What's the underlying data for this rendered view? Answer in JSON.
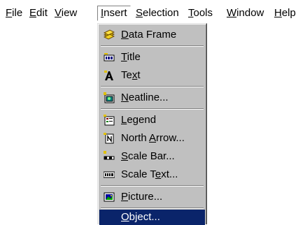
{
  "menubar": {
    "items": [
      {
        "accel": "F",
        "rest": "ile"
      },
      {
        "accel": "E",
        "rest": "dit"
      },
      {
        "accel": "V",
        "rest": "iew"
      },
      {
        "accel": "I",
        "rest": "nsert"
      },
      {
        "accel": "S",
        "rest": "election"
      },
      {
        "accel": "T",
        "rest": "ools"
      },
      {
        "accel": "W",
        "rest": "indow"
      },
      {
        "accel": "H",
        "rest": "elp"
      }
    ]
  },
  "insert_menu": {
    "items": [
      {
        "pre": "",
        "accel": "D",
        "post": "ata Frame",
        "icon": "data-frame-icon"
      },
      {
        "pre": "",
        "accel": "T",
        "post": "itle",
        "icon": "title-icon"
      },
      {
        "pre": "Te",
        "accel": "x",
        "post": "t",
        "icon": "text-icon"
      },
      {
        "pre": "",
        "accel": "N",
        "post": "eatline...",
        "icon": "neatline-icon"
      },
      {
        "pre": "",
        "accel": "L",
        "post": "egend",
        "icon": "legend-icon"
      },
      {
        "pre": "North ",
        "accel": "A",
        "post": "rrow...",
        "icon": "north-arrow-icon"
      },
      {
        "pre": "",
        "accel": "S",
        "post": "cale Bar...",
        "icon": "scale-bar-icon"
      },
      {
        "pre": "Scale T",
        "accel": "e",
        "post": "xt...",
        "icon": "scale-text-icon"
      },
      {
        "pre": "",
        "accel": "P",
        "post": "icture...",
        "icon": "picture-icon"
      },
      {
        "pre": "",
        "accel": "O",
        "post": "bject...",
        "icon": ""
      }
    ],
    "highlighted_item": "Object..."
  },
  "colors": {
    "menu_background": "#c0c0c0",
    "highlight": "#0a246a",
    "highlight_text": "#ffffff"
  }
}
